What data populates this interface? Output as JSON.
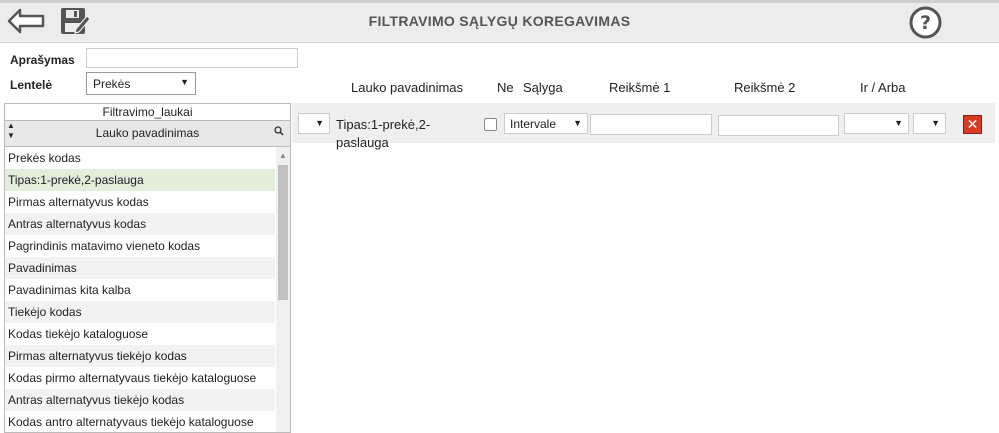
{
  "header": {
    "title": "FILTRAVIMO SĄLYGŲ KOREGAVIMAS"
  },
  "icons": {
    "back": "back-arrow-icon",
    "save": "save-edit-icon",
    "help": "help-question-icon"
  },
  "form": {
    "description_label": "Aprašymas",
    "description_value": "",
    "table_label": "Lentelė",
    "table_value": "Prekės"
  },
  "left_panel": {
    "title": "Filtravimo_laukai",
    "column_header": "Lauko pavadinimas",
    "selected_index": 1,
    "items": [
      "Prekės kodas",
      "Tipas:1-prekė,2-paslauga",
      "Pirmas alternatyvus kodas",
      "Antras alternatyvus kodas",
      "Pagrindinis matavimo vieneto kodas",
      "Pavadinimas",
      "Pavadinimas kita kalba",
      "Tiekėjo kodas",
      "Kodas tiekėjo kataloguose",
      "Pirmas alternatyvus tiekėjo kodas",
      "Kodas pirmo alternatyvaus tiekėjo kataloguose",
      "Antras alternatyvus tiekėjo kodas",
      "Kodas antro alternatyvaus tiekėjo kataloguose"
    ]
  },
  "conditions_table": {
    "headers": {
      "field": "Lauko pavadinimas",
      "negate": "Ne",
      "condition": "Sąlyga",
      "value1": "Reikšmė 1",
      "value2": "Reikšmė 2",
      "and_or": "Ir / Arba"
    },
    "rows": [
      {
        "field_line1": "Tipas:1-prekė,2-",
        "field_line2": "paslauga",
        "bracket_open": "",
        "negated": false,
        "condition": "Intervale",
        "value1": "",
        "value2": "",
        "and_or": "",
        "bracket_close": ""
      }
    ]
  },
  "colors": {
    "delete_button": "#d93b22",
    "selected_row": "#e2eddc",
    "toolbar": "#ececec"
  }
}
